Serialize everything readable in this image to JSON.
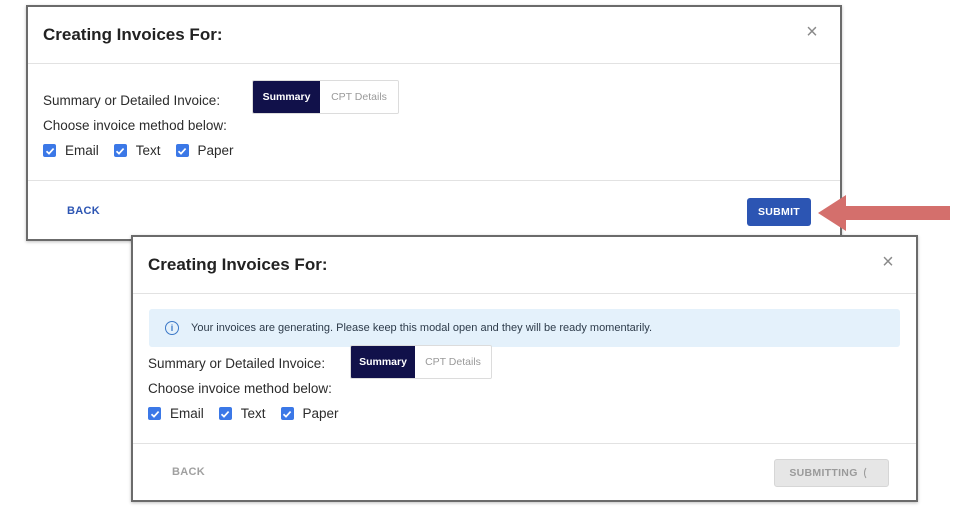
{
  "modal_top": {
    "title": "Creating Invoices For:",
    "close_glyph": "×",
    "invoice_type_label": "Summary or Detailed Invoice:",
    "toggle": {
      "selected": "Summary",
      "other": "CPT Details"
    },
    "method_label": "Choose invoice method below:",
    "methods": [
      {
        "label": "Email",
        "checked": true
      },
      {
        "label": "Text",
        "checked": true
      },
      {
        "label": "Paper",
        "checked": true
      }
    ],
    "back_label": "BACK",
    "submit_label": "SUBMIT"
  },
  "modal_bottom": {
    "title": "Creating Invoices For:",
    "close_glyph": "×",
    "alert_text": "Your invoices are generating. Please keep this modal open and they will be ready momentarily.",
    "alert_icon_glyph": "i",
    "invoice_type_label": "Summary or Detailed Invoice:",
    "toggle": {
      "selected": "Summary",
      "other": "CPT Details"
    },
    "method_label": "Choose invoice method below:",
    "methods": [
      {
        "label": "Email",
        "checked": true
      },
      {
        "label": "Text",
        "checked": true
      },
      {
        "label": "Paper",
        "checked": true
      }
    ],
    "back_label": "BACK",
    "submit_label": "SUBMITTING"
  },
  "icons": {
    "close": "close-icon",
    "check": "checkmark-icon",
    "info": "info-icon",
    "spinner": "spinner-icon",
    "arrow": "arrow-left-icon"
  },
  "colors": {
    "toggle_selected_bg": "#11114a",
    "submit_bg": "#2c55b3",
    "back_text": "#2c55b3",
    "checkbox": "#3b78e7",
    "alert_bg": "#e4f1fb",
    "disabled_bg": "#e6e6e6",
    "disabled_text": "#9a9a9a",
    "annotation_arrow": "#d46f6c"
  }
}
